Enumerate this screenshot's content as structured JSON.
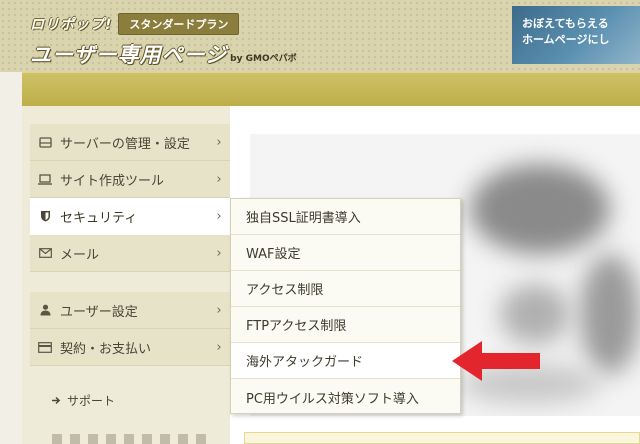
{
  "header": {
    "brand": "ロリポップ!",
    "plan_badge": "スタンダードプラン",
    "site_title": "ユーザー専用ページ",
    "byline": "by GMOペパボ",
    "banner_line1": "おぼえてもらえる",
    "banner_line2": "ホームページにし"
  },
  "sidebar": {
    "items": [
      {
        "label": "サーバーの管理・設定",
        "icon": "server-icon"
      },
      {
        "label": "サイト作成ツール",
        "icon": "laptop-icon"
      },
      {
        "label": "セキュリティ",
        "icon": "shield-icon"
      },
      {
        "label": "メール",
        "icon": "mail-icon"
      },
      {
        "label": "ユーザー設定",
        "icon": "user-icon"
      },
      {
        "label": "契約・お支払い",
        "icon": "card-icon"
      }
    ],
    "chevron": "›",
    "support": "サポート"
  },
  "dropdown": {
    "items": [
      {
        "label": "独自SSL証明書導入"
      },
      {
        "label": "WAF設定"
      },
      {
        "label": "アクセス制限"
      },
      {
        "label": "FTPアクセス制限"
      },
      {
        "label": "海外アタックガード"
      },
      {
        "label": "PC用ウイルス対策ソフト導入"
      }
    ]
  },
  "colors": {
    "header_bg": "#d9d3ae",
    "gold_bar": "#c4b653",
    "sidebar_bg": "#e7e3c9",
    "arrow": "#e3262e"
  }
}
